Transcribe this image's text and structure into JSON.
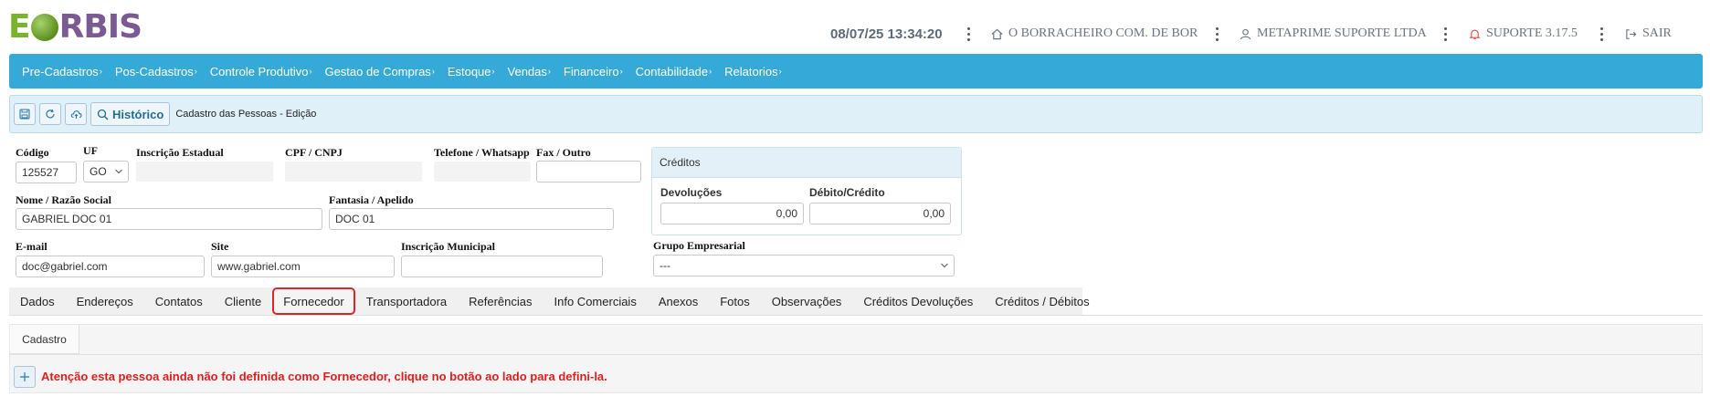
{
  "header": {
    "logo_e": "E",
    "logo_rest": "RBIS",
    "datetime": "08/07/25 13:34:20",
    "company": "O BORRACHEIRO COM. DE BOR",
    "user": "METAPRIME SUPORTE LTDA",
    "support": "SUPORTE 3.17.5",
    "logout": "SAIR"
  },
  "menu": {
    "items": [
      {
        "label": "Pre-Cadastros"
      },
      {
        "label": "Pos-Cadastros"
      },
      {
        "label": "Controle Produtivo"
      },
      {
        "label": "Gestao de Compras"
      },
      {
        "label": "Estoque"
      },
      {
        "label": "Vendas"
      },
      {
        "label": "Financeiro"
      },
      {
        "label": "Contabilidade"
      },
      {
        "label": "Relatorios"
      }
    ],
    "caret": "›"
  },
  "toolbar": {
    "history_label": "Histórico",
    "title": "Cadastro das Pessoas - Edição"
  },
  "form": {
    "codigo_label": "Código",
    "codigo_value": "125527",
    "uf_label": "UF",
    "uf_value": "GO",
    "ie_label": "Inscrição Estadual",
    "cpf_label": "CPF / CNPJ",
    "telefone_label": "Telefone / Whatsapp",
    "fax_label": "Fax / Outro",
    "fax_value": "",
    "nome_label": "Nome / Razão Social",
    "nome_value": "GABRIEL DOC 01",
    "fantasia_label": "Fantasia / Apelido",
    "fantasia_value": "DOC 01",
    "email_label": "E-mail",
    "email_value": "doc@gabriel.com",
    "site_label": "Site",
    "site_value": "www.gabriel.com",
    "im_label": "Inscrição Municipal",
    "im_value": "",
    "grupo_label": "Grupo Empresarial",
    "grupo_value": "---"
  },
  "credits": {
    "title": "Créditos",
    "devolucoes_label": "Devoluções",
    "devolucoes_value": "0,00",
    "debito_label": "Débito/Crédito",
    "debito_value": "0,00"
  },
  "tabs": [
    {
      "label": "Dados"
    },
    {
      "label": "Endereços"
    },
    {
      "label": "Contatos"
    },
    {
      "label": "Cliente"
    },
    {
      "label": "Fornecedor"
    },
    {
      "label": "Transportadora"
    },
    {
      "label": "Referências"
    },
    {
      "label": "Info Comerciais"
    },
    {
      "label": "Anexos"
    },
    {
      "label": "Fotos"
    },
    {
      "label": "Observações"
    },
    {
      "label": "Créditos Devoluções"
    },
    {
      "label": "Créditos / Débitos"
    }
  ],
  "active_tab": "Fornecedor",
  "subpanel": {
    "subtab": "Cadastro",
    "warning": "Atenção esta pessoa ainda não foi definida como Fornecedor, clique no botão ao lado para defini-la."
  },
  "colors": {
    "menubar": "#35aad9",
    "warning": "#e01d1d",
    "active_tab_border": "#d8262a"
  }
}
